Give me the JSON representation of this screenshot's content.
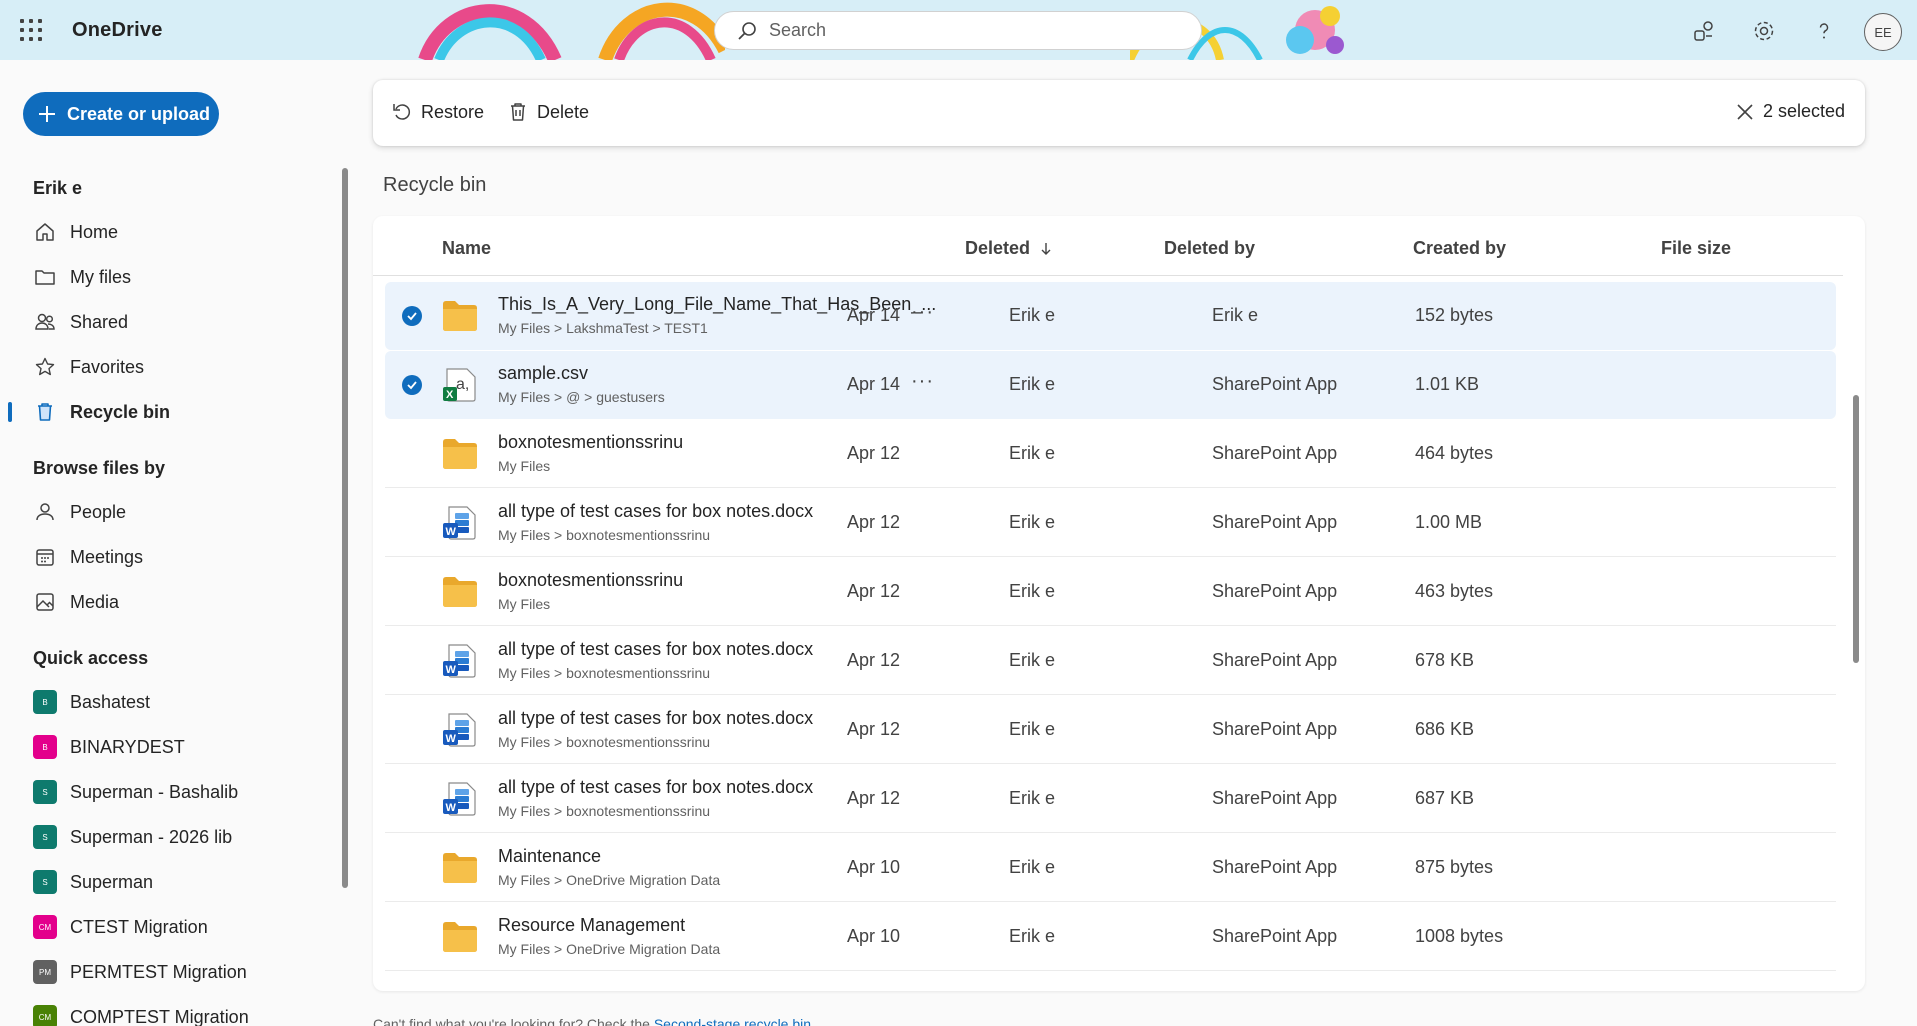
{
  "header": {
    "app_name": "OneDrive",
    "search_placeholder": "Search",
    "avatar_initials": "EE",
    "icons": [
      "waffle-icon",
      "search-icon",
      "share-settings-icon",
      "gear-icon",
      "help-icon"
    ]
  },
  "sidebar": {
    "create_label": "Create or upload",
    "user_section": "Erik e",
    "nav": [
      {
        "label": "Home",
        "icon": "home-icon"
      },
      {
        "label": "My files",
        "icon": "folder-icon"
      },
      {
        "label": "Shared",
        "icon": "people-icon"
      },
      {
        "label": "Favorites",
        "icon": "star-icon"
      },
      {
        "label": "Recycle bin",
        "icon": "trash-icon",
        "active": true
      }
    ],
    "browse_section": "Browse files by",
    "browse": [
      {
        "label": "People",
        "icon": "person-icon"
      },
      {
        "label": "Meetings",
        "icon": "calendar-icon"
      },
      {
        "label": "Media",
        "icon": "image-icon"
      }
    ],
    "quick_section": "Quick access",
    "quick": [
      {
        "label": "Bashatest",
        "badge": "B",
        "color": "#0e7a6d"
      },
      {
        "label": "BINARYDEST",
        "badge": "B",
        "color": "#e3008c"
      },
      {
        "label": "Superman - Bashalib",
        "badge": "S",
        "color": "#0e7a6d"
      },
      {
        "label": "Superman - 2026 lib",
        "badge": "S",
        "color": "#0e7a6d"
      },
      {
        "label": "Superman",
        "badge": "S",
        "color": "#0e7a6d"
      },
      {
        "label": "CTEST Migration",
        "badge": "CM",
        "color": "#e3008c"
      },
      {
        "label": "PERMTEST Migration",
        "badge": "PM",
        "color": "#616161"
      },
      {
        "label": "COMPTEST Migration",
        "badge": "CM",
        "color": "#498205"
      }
    ]
  },
  "commandbar": {
    "restore": "Restore",
    "delete": "Delete",
    "selected": "2 selected"
  },
  "page_title": "Recycle bin",
  "table": {
    "columns": {
      "name": "Name",
      "deleted": "Deleted",
      "deleted_by": "Deleted by",
      "created_by": "Created by",
      "size": "File size"
    },
    "rows": [
      {
        "name": "This_Is_A_Very_Long_File_Name_That_Has_Been_...",
        "path": "My Files > LakshmaTest > TEST1",
        "type": "folder",
        "deleted": "Apr 14",
        "deleted_by": "Erik e",
        "created_by": "Erik e",
        "size": "152 bytes",
        "selected": true
      },
      {
        "name": "sample.csv",
        "path": "My Files > @ > guestusers",
        "type": "csv",
        "deleted": "Apr 14",
        "deleted_by": "Erik e",
        "created_by": "SharePoint App",
        "size": "1.01 KB",
        "selected": true
      },
      {
        "name": "boxnotesmentionssrinu",
        "path": "My Files",
        "type": "folder",
        "deleted": "Apr 12",
        "deleted_by": "Erik e",
        "created_by": "SharePoint App",
        "size": "464 bytes",
        "selected": false
      },
      {
        "name": "all type of test cases for box notes.docx",
        "path": "My Files > boxnotesmentionssrinu",
        "type": "word",
        "deleted": "Apr 12",
        "deleted_by": "Erik e",
        "created_by": "SharePoint App",
        "size": "1.00 MB",
        "selected": false
      },
      {
        "name": "boxnotesmentionssrinu",
        "path": "My Files",
        "type": "folder",
        "deleted": "Apr 12",
        "deleted_by": "Erik e",
        "created_by": "SharePoint App",
        "size": "463 bytes",
        "selected": false
      },
      {
        "name": "all type of test cases for box notes.docx",
        "path": "My Files > boxnotesmentionssrinu",
        "type": "word",
        "deleted": "Apr 12",
        "deleted_by": "Erik e",
        "created_by": "SharePoint App",
        "size": "678 KB",
        "selected": false
      },
      {
        "name": "all type of test cases for box notes.docx",
        "path": "My Files > boxnotesmentionssrinu",
        "type": "word",
        "deleted": "Apr 12",
        "deleted_by": "Erik e",
        "created_by": "SharePoint App",
        "size": "686 KB",
        "selected": false
      },
      {
        "name": "all type of test cases for box notes.docx",
        "path": "My Files > boxnotesmentionssrinu",
        "type": "word",
        "deleted": "Apr 12",
        "deleted_by": "Erik e",
        "created_by": "SharePoint App",
        "size": "687 KB",
        "selected": false
      },
      {
        "name": "Maintenance",
        "path": "My Files > OneDrive Migration Data",
        "type": "folder",
        "deleted": "Apr 10",
        "deleted_by": "Erik e",
        "created_by": "SharePoint App",
        "size": "875 bytes",
        "selected": false
      },
      {
        "name": "Resource Management",
        "path": "My Files > OneDrive Migration Data",
        "type": "folder",
        "deleted": "Apr 10",
        "deleted_by": "Erik e",
        "created_by": "SharePoint App",
        "size": "1008 bytes",
        "selected": false
      }
    ]
  },
  "footer": {
    "text": "Can't find what you're looking for? Check the ",
    "link": "Second-stage recycle bin"
  },
  "colors": {
    "accent": "#0f6cbd",
    "header_bg": "#d7eef7",
    "selected_row": "#ebf3fc",
    "folder": "#f6b83e"
  }
}
